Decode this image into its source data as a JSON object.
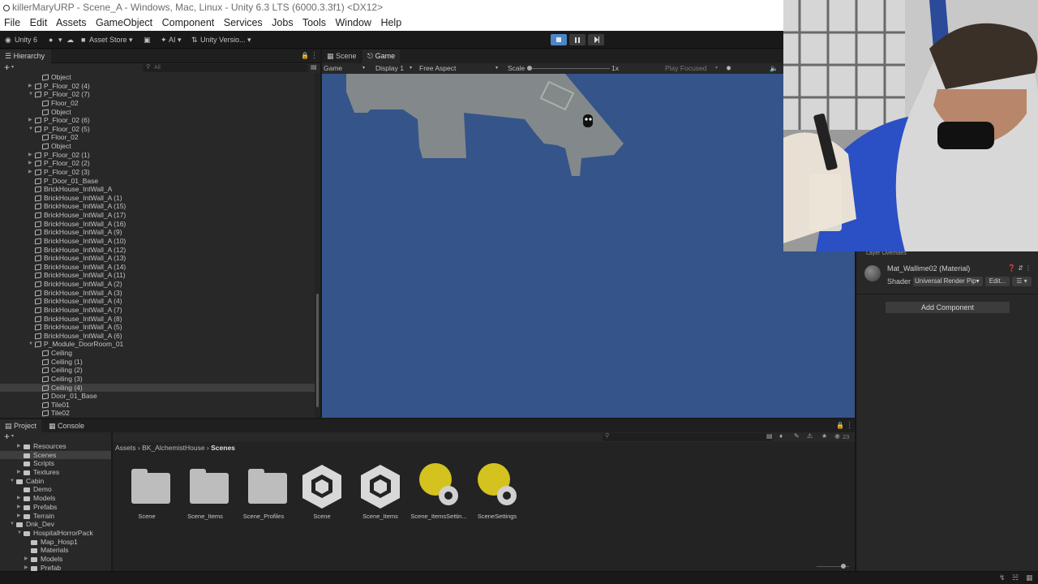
{
  "window": {
    "title": "killerMaryURP - Scene_A - Windows, Mac, Linux - Unity 6.3 LTS (6000.3.3f1) <DX12>"
  },
  "menu": [
    "File",
    "Edit",
    "Assets",
    "GameObject",
    "Component",
    "Services",
    "Jobs",
    "Tools",
    "Window",
    "Help"
  ],
  "toolbar": {
    "unity_label": "Unity 6",
    "account_label": "▾",
    "asset_store_label": "Asset Store ▾",
    "ai_label": "AI ▾",
    "version_control_label": "Unity Versio... ▾"
  },
  "hierarchy": {
    "tab_label": "Hierarchy",
    "search_placeholder": "All",
    "rows": [
      {
        "label": "Object",
        "depth": 2,
        "arrow": ""
      },
      {
        "label": "P_Floor_02 (4)",
        "depth": 1,
        "arrow": "▶"
      },
      {
        "label": "P_Floor_02 (7)",
        "depth": 1,
        "arrow": "▼"
      },
      {
        "label": "Floor_02",
        "depth": 2,
        "arrow": ""
      },
      {
        "label": "Object",
        "depth": 2,
        "arrow": ""
      },
      {
        "label": "P_Floor_02 (6)",
        "depth": 1,
        "arrow": "▶"
      },
      {
        "label": "P_Floor_02 (5)",
        "depth": 1,
        "arrow": "▼"
      },
      {
        "label": "Floor_02",
        "depth": 2,
        "arrow": ""
      },
      {
        "label": "Object",
        "depth": 2,
        "arrow": ""
      },
      {
        "label": "P_Floor_02 (1)",
        "depth": 1,
        "arrow": "▶"
      },
      {
        "label": "P_Floor_02 (2)",
        "depth": 1,
        "arrow": "▶"
      },
      {
        "label": "P_Floor_02 (3)",
        "depth": 1,
        "arrow": "▶"
      },
      {
        "label": "P_Door_01_Base",
        "depth": 1,
        "arrow": ""
      },
      {
        "label": "BrickHouse_IntWall_A",
        "depth": 1,
        "arrow": ""
      },
      {
        "label": "BrickHouse_IntWall_A (1)",
        "depth": 1,
        "arrow": ""
      },
      {
        "label": "BrickHouse_IntWall_A (15)",
        "depth": 1,
        "arrow": ""
      },
      {
        "label": "BrickHouse_IntWall_A (17)",
        "depth": 1,
        "arrow": ""
      },
      {
        "label": "BrickHouse_IntWall_A (16)",
        "depth": 1,
        "arrow": ""
      },
      {
        "label": "BrickHouse_IntWall_A (9)",
        "depth": 1,
        "arrow": ""
      },
      {
        "label": "BrickHouse_IntWall_A (10)",
        "depth": 1,
        "arrow": ""
      },
      {
        "label": "BrickHouse_IntWall_A (12)",
        "depth": 1,
        "arrow": ""
      },
      {
        "label": "BrickHouse_IntWall_A (13)",
        "depth": 1,
        "arrow": ""
      },
      {
        "label": "BrickHouse_IntWall_A (14)",
        "depth": 1,
        "arrow": ""
      },
      {
        "label": "BrickHouse_IntWall_A (11)",
        "depth": 1,
        "arrow": ""
      },
      {
        "label": "BrickHouse_IntWall_A (2)",
        "depth": 1,
        "arrow": ""
      },
      {
        "label": "BrickHouse_IntWall_A (3)",
        "depth": 1,
        "arrow": ""
      },
      {
        "label": "BrickHouse_IntWall_A (4)",
        "depth": 1,
        "arrow": ""
      },
      {
        "label": "BrickHouse_IntWall_A (7)",
        "depth": 1,
        "arrow": ""
      },
      {
        "label": "BrickHouse_IntWall_A (8)",
        "depth": 1,
        "arrow": ""
      },
      {
        "label": "BrickHouse_IntWall_A (5)",
        "depth": 1,
        "arrow": ""
      },
      {
        "label": "BrickHouse_IntWall_A (6)",
        "depth": 1,
        "arrow": ""
      },
      {
        "label": "P_Module_DoorRoom_01",
        "depth": 1,
        "arrow": "▼"
      },
      {
        "label": "Ceiling",
        "depth": 2,
        "arrow": ""
      },
      {
        "label": "Ceiling (1)",
        "depth": 2,
        "arrow": ""
      },
      {
        "label": "Ceiling (2)",
        "depth": 2,
        "arrow": ""
      },
      {
        "label": "Ceiling (3)",
        "depth": 2,
        "arrow": ""
      },
      {
        "label": "Ceiling (4)",
        "depth": 2,
        "arrow": "",
        "selected": true
      },
      {
        "label": "Door_01_Base",
        "depth": 2,
        "arrow": ""
      },
      {
        "label": "Tile01",
        "depth": 2,
        "arrow": ""
      },
      {
        "label": "Tile02",
        "depth": 2,
        "arrow": ""
      }
    ]
  },
  "game_view": {
    "tabs": [
      "Scene",
      "Game"
    ],
    "active_tab": "Game",
    "mode_label": "Game",
    "display_label": "Display 1",
    "aspect_label": "Free Aspect",
    "scale_label": "Scale",
    "scale_value": "1x",
    "play_focused_label": "Play Focused",
    "view_bg_color": "#34548a"
  },
  "inspector": {
    "header_label": "Layer Overrides",
    "material_name": "Mat_Wallime02 (Material)",
    "shader_label": "Shader",
    "shader_value": "Universal Render Pip▾",
    "edit_label": "Edit...",
    "list_label": "☰ ▾",
    "add_component_label": "Add Component"
  },
  "project": {
    "tabs": [
      "Project",
      "Console"
    ],
    "tree": [
      {
        "label": "Resources",
        "depth": 2,
        "arrow": "▶"
      },
      {
        "label": "Scenes",
        "depth": 2,
        "arrow": "",
        "selected": true
      },
      {
        "label": "Scripts",
        "depth": 2,
        "arrow": ""
      },
      {
        "label": "Textures",
        "depth": 2,
        "arrow": "▶"
      },
      {
        "label": "Cabin",
        "depth": 1,
        "arrow": "▼"
      },
      {
        "label": "Demo",
        "depth": 2,
        "arrow": ""
      },
      {
        "label": "Models",
        "depth": 2,
        "arrow": "▶"
      },
      {
        "label": "Prefabs",
        "depth": 2,
        "arrow": "▶"
      },
      {
        "label": "Terrain",
        "depth": 2,
        "arrow": "▶"
      },
      {
        "label": "Dnk_Dev",
        "depth": 1,
        "arrow": "▼"
      },
      {
        "label": "HospitalHorrorPack",
        "depth": 2,
        "arrow": "▼"
      },
      {
        "label": "Map_Hosp1",
        "depth": 3,
        "arrow": ""
      },
      {
        "label": "Materials",
        "depth": 3,
        "arrow": ""
      },
      {
        "label": "Models",
        "depth": 3,
        "arrow": "▶"
      },
      {
        "label": "Prefab",
        "depth": 3,
        "arrow": "▶"
      }
    ],
    "breadcrumb": [
      "Assets",
      "BK_AlchemistHouse",
      "Scenes"
    ],
    "asset_count": "23",
    "assets": [
      {
        "label": "Scene",
        "kind": "folder"
      },
      {
        "label": "Scene_Items",
        "kind": "folder"
      },
      {
        "label": "Scene_Profiles",
        "kind": "folder"
      },
      {
        "label": "Scene",
        "kind": "unity"
      },
      {
        "label": "Scene_Items",
        "kind": "unity"
      },
      {
        "label": "Scene_ItemsSettin...",
        "kind": "settings"
      },
      {
        "label": "SceneSettings",
        "kind": "settings"
      }
    ]
  },
  "colors": {
    "accent": "#4c86c7",
    "settings_icon": "#d4c21e"
  }
}
